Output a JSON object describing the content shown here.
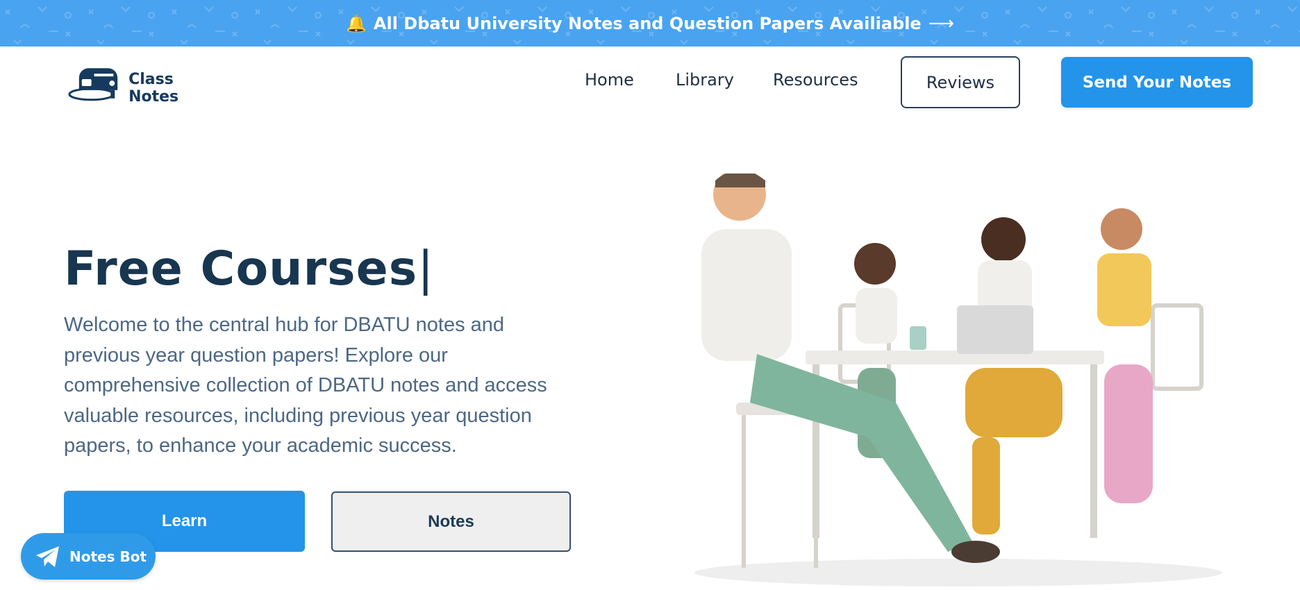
{
  "announcement": {
    "emoji": "🔔",
    "text": "All Dbatu University Notes and Question Papers Availiable",
    "arrow": "⟶"
  },
  "header": {
    "logo_text": "Class Notes",
    "nav": [
      {
        "label": "Home"
      },
      {
        "label": "Library"
      },
      {
        "label": "Resources"
      }
    ],
    "reviews_label": "Reviews",
    "send_notes_label": "Send Your Notes"
  },
  "hero": {
    "title": "Free Courses",
    "caret": "|",
    "description": "Welcome to the central hub for DBATU notes and previous year question papers! Explore our comprehensive collection of DBATU notes and access valuable resources, including previous year question papers, to enhance your academic success.",
    "learn_label": "Learn",
    "notes_label": "Notes"
  },
  "bot": {
    "label": "Notes Bot"
  },
  "colors": {
    "announce_bg": "#4aa3f0",
    "primary": "#2394ea",
    "heading": "#183650",
    "body_text": "#4c6784"
  },
  "icons": {
    "logo": "train-mailbox-logo-icon",
    "bot": "telegram-icon"
  }
}
